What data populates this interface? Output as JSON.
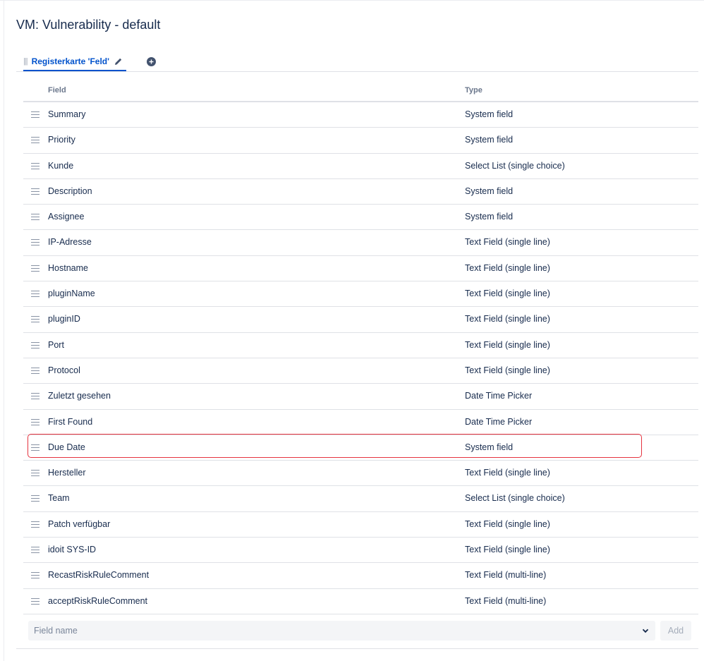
{
  "screen": {
    "title": "VM: Vulnerability - default"
  },
  "tabs": [
    {
      "label": "Registerkarte 'Feld'",
      "active": true
    }
  ],
  "table": {
    "headers": {
      "field": "Field",
      "type": "Type"
    },
    "rows": [
      {
        "name": "Summary",
        "type": "System field"
      },
      {
        "name": "Priority",
        "type": "System field"
      },
      {
        "name": "Kunde",
        "type": "Select List (single choice)"
      },
      {
        "name": "Description",
        "type": "System field"
      },
      {
        "name": "Assignee",
        "type": "System field"
      },
      {
        "name": "IP-Adresse",
        "type": "Text Field (single line)"
      },
      {
        "name": "Hostname",
        "type": "Text Field (single line)"
      },
      {
        "name": "pluginName",
        "type": "Text Field (single line)"
      },
      {
        "name": "pluginID",
        "type": "Text Field (single line)"
      },
      {
        "name": "Port",
        "type": "Text Field (single line)"
      },
      {
        "name": "Protocol",
        "type": "Text Field (single line)"
      },
      {
        "name": "Zuletzt gesehen",
        "type": "Date Time Picker"
      },
      {
        "name": "First Found",
        "type": "Date Time Picker"
      },
      {
        "name": "Due Date",
        "type": "System field",
        "highlighted": true
      },
      {
        "name": "Hersteller",
        "type": "Text Field (single line)"
      },
      {
        "name": "Team",
        "type": "Select List (single choice)"
      },
      {
        "name": "Patch verfügbar",
        "type": "Text Field (single line)"
      },
      {
        "name": "idoit SYS-ID",
        "type": "Text Field (single line)"
      },
      {
        "name": "RecastRiskRuleComment",
        "type": "Text Field (multi-line)"
      },
      {
        "name": "acceptRiskRuleComment",
        "type": "Text Field (multi-line)"
      }
    ]
  },
  "add_field": {
    "placeholder": "Field name",
    "add_label": "Add"
  },
  "colors": {
    "accent": "#0052cc",
    "highlight": "#e5333f",
    "border": "#dfe1e6"
  }
}
